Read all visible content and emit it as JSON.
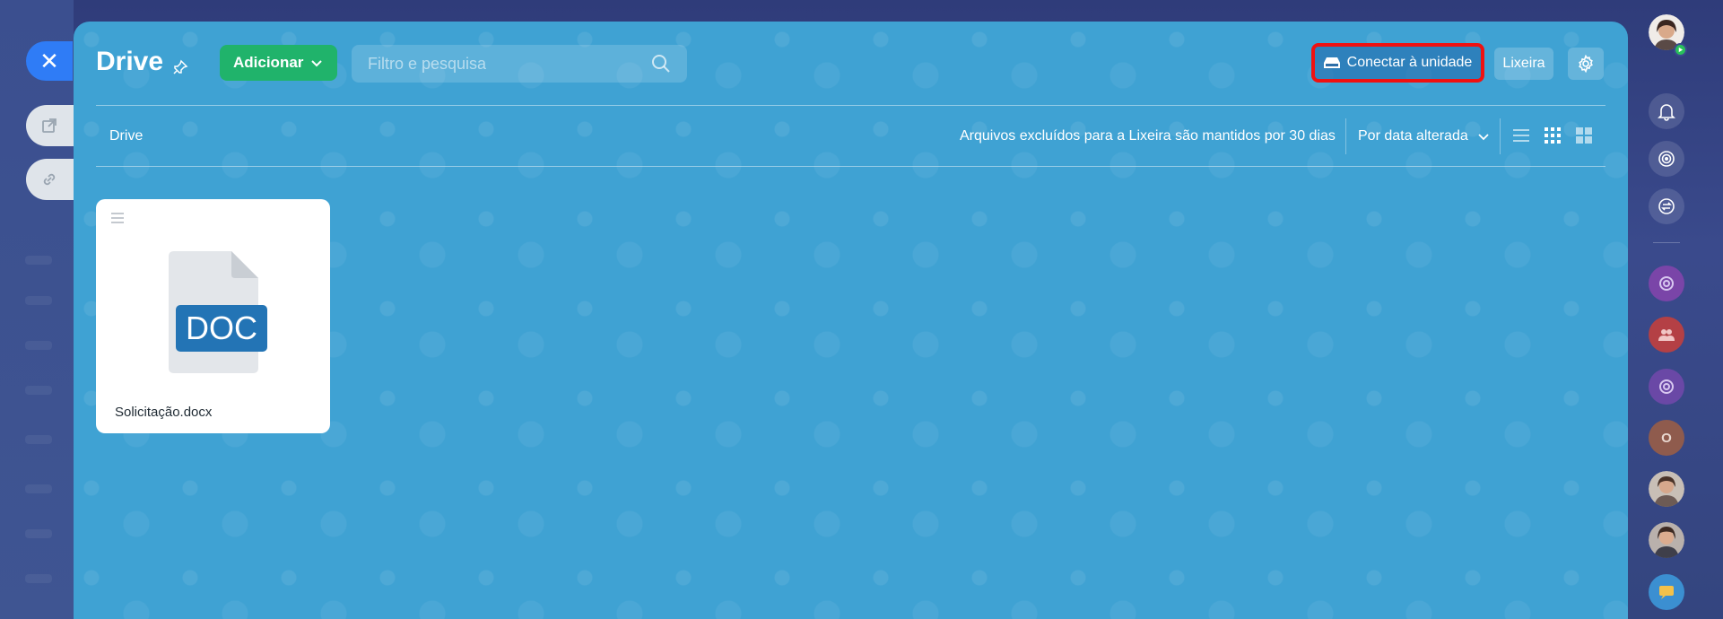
{
  "app": {
    "title": "Drive",
    "add_button": "Adicionar",
    "search_placeholder": "Filtro e pesquisa",
    "connect_button": "Conectar à unidade",
    "trash_button": "Lixeira"
  },
  "toolbar": {
    "breadcrumb": "Drive",
    "retention_notice": "Arquivos excluídos para a Lixeira são mantidos por 30 dias",
    "sort_label": "Por data alterada",
    "view_modes": [
      "list-view-icon",
      "grid-view-icon",
      "tile-view-icon"
    ]
  },
  "files": [
    {
      "name": "Solicitação.docx",
      "type_label": "DOC"
    }
  ],
  "rail": {
    "letter_avatar": "O"
  },
  "colors": {
    "panel": "#3fa2d3",
    "add_button": "#20b36b",
    "highlight_border": "#f01111",
    "close_button": "#2f7cf6"
  }
}
